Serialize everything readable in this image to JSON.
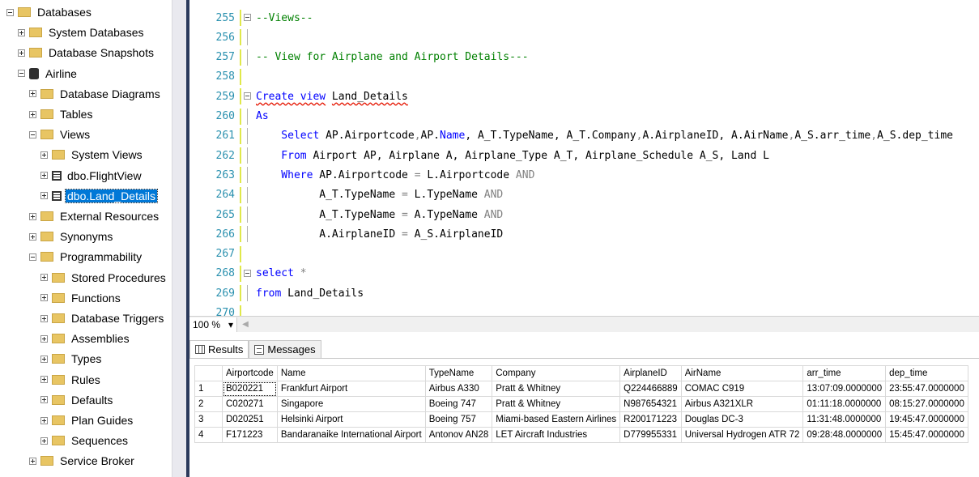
{
  "explorer": {
    "nodes": [
      {
        "label": "Databases",
        "exp": "minus",
        "icon": "folder",
        "indent": 0
      },
      {
        "label": "System Databases",
        "exp": "plus",
        "icon": "folder",
        "indent": 1
      },
      {
        "label": "Database Snapshots",
        "exp": "plus",
        "icon": "folder",
        "indent": 1
      },
      {
        "label": "Airline",
        "exp": "minus",
        "icon": "database",
        "indent": 1
      },
      {
        "label": "Database Diagrams",
        "exp": "plus",
        "icon": "folder",
        "indent": 2
      },
      {
        "label": "Tables",
        "exp": "plus",
        "icon": "folder",
        "indent": 2
      },
      {
        "label": "Views",
        "exp": "minus",
        "icon": "folder",
        "indent": 2
      },
      {
        "label": "System Views",
        "exp": "plus",
        "icon": "folder",
        "indent": 3
      },
      {
        "label": "dbo.FlightView",
        "exp": "plus",
        "icon": "view",
        "indent": 3
      },
      {
        "label": "dbo.Land_Details",
        "exp": "plus",
        "icon": "view",
        "indent": 3,
        "selected": true
      },
      {
        "label": "External Resources",
        "exp": "plus",
        "icon": "folder",
        "indent": 2
      },
      {
        "label": "Synonyms",
        "exp": "plus",
        "icon": "folder",
        "indent": 2
      },
      {
        "label": "Programmability",
        "exp": "minus",
        "icon": "folder",
        "indent": 2
      },
      {
        "label": "Stored Procedures",
        "exp": "plus",
        "icon": "folder",
        "indent": 3
      },
      {
        "label": "Functions",
        "exp": "plus",
        "icon": "folder",
        "indent": 3
      },
      {
        "label": "Database Triggers",
        "exp": "plus",
        "icon": "folder",
        "indent": 3
      },
      {
        "label": "Assemblies",
        "exp": "plus",
        "icon": "folder",
        "indent": 3
      },
      {
        "label": "Types",
        "exp": "plus",
        "icon": "folder",
        "indent": 3
      },
      {
        "label": "Rules",
        "exp": "plus",
        "icon": "folder",
        "indent": 3
      },
      {
        "label": "Defaults",
        "exp": "plus",
        "icon": "folder",
        "indent": 3
      },
      {
        "label": "Plan Guides",
        "exp": "plus",
        "icon": "folder",
        "indent": 3
      },
      {
        "label": "Sequences",
        "exp": "plus",
        "icon": "folder",
        "indent": 3
      },
      {
        "label": "Service Broker",
        "exp": "plus",
        "icon": "folder",
        "indent": 2
      }
    ]
  },
  "editor": {
    "lines": [
      {
        "num": "255",
        "fold": "box",
        "bar": true,
        "tokens": [
          {
            "t": "--Views--",
            "c": "cm"
          }
        ]
      },
      {
        "num": "256",
        "fold": "line",
        "bar": true,
        "tokens": []
      },
      {
        "num": "257",
        "fold": "line",
        "bar": true,
        "tokens": [
          {
            "t": "-- View for Airplane and Airport Details---",
            "c": "cm"
          }
        ]
      },
      {
        "num": "258",
        "fold": "",
        "bar": true,
        "tokens": []
      },
      {
        "num": "259",
        "fold": "box",
        "bar": true,
        "tokens": [
          {
            "t": "Create view",
            "c": "kw sq"
          },
          {
            "t": " ",
            "c": ""
          },
          {
            "t": "Land_Details",
            "c": "sq"
          }
        ]
      },
      {
        "num": "260",
        "fold": "line",
        "bar": true,
        "tokens": [
          {
            "t": "As",
            "c": "kw"
          }
        ]
      },
      {
        "num": "261",
        "fold": "line",
        "bar": true,
        "tokens": [
          {
            "t": "    Select",
            "c": "kw"
          },
          {
            "t": " AP.Airportcode",
            "c": ""
          },
          {
            "t": ",",
            "c": "op"
          },
          {
            "t": "AP.",
            "c": ""
          },
          {
            "t": "Name",
            "c": "kw"
          },
          {
            "t": ", A_T.TypeName, A_T.Company",
            "c": ""
          },
          {
            "t": ",",
            "c": "op"
          },
          {
            "t": "A.AirplaneID, A.AirName",
            "c": ""
          },
          {
            "t": ",",
            "c": "op"
          },
          {
            "t": "A_S.arr_time",
            "c": ""
          },
          {
            "t": ",",
            "c": "op"
          },
          {
            "t": "A_S.dep_time",
            "c": ""
          }
        ]
      },
      {
        "num": "262",
        "fold": "line",
        "bar": true,
        "tokens": [
          {
            "t": "    From",
            "c": "kw"
          },
          {
            "t": " Airport AP, Airplane A, Airplane_Type A_T, Airplane_Schedule A_S, Land L",
            "c": ""
          }
        ]
      },
      {
        "num": "263",
        "fold": "line",
        "bar": true,
        "tokens": [
          {
            "t": "    Where",
            "c": "kw"
          },
          {
            "t": " AP.Airportcode ",
            "c": ""
          },
          {
            "t": "=",
            "c": "op"
          },
          {
            "t": " L.Airportcode ",
            "c": ""
          },
          {
            "t": "AND",
            "c": "op"
          }
        ]
      },
      {
        "num": "264",
        "fold": "line",
        "bar": true,
        "tokens": [
          {
            "t": "          A_T.TypeName ",
            "c": ""
          },
          {
            "t": "=",
            "c": "op"
          },
          {
            "t": " L.TypeName ",
            "c": ""
          },
          {
            "t": "AND",
            "c": "op"
          }
        ]
      },
      {
        "num": "265",
        "fold": "line",
        "bar": true,
        "tokens": [
          {
            "t": "          A_T.TypeName ",
            "c": ""
          },
          {
            "t": "=",
            "c": "op"
          },
          {
            "t": " A.TypeName ",
            "c": ""
          },
          {
            "t": "AND",
            "c": "op"
          }
        ]
      },
      {
        "num": "266",
        "fold": "line",
        "bar": true,
        "tokens": [
          {
            "t": "          A.AirplaneID ",
            "c": ""
          },
          {
            "t": "=",
            "c": "op"
          },
          {
            "t": " A_S.AirplaneID",
            "c": ""
          }
        ]
      },
      {
        "num": "267",
        "fold": "",
        "bar": true,
        "tokens": []
      },
      {
        "num": "268",
        "fold": "box",
        "bar": true,
        "tokens": [
          {
            "t": "select",
            "c": "kw"
          },
          {
            "t": " ",
            "c": ""
          },
          {
            "t": "*",
            "c": "op"
          }
        ]
      },
      {
        "num": "269",
        "fold": "line",
        "bar": true,
        "tokens": [
          {
            "t": "from",
            "c": "kw"
          },
          {
            "t": " Land_Details",
            "c": ""
          }
        ]
      },
      {
        "num": "270",
        "fold": "",
        "bar": true,
        "tokens": []
      }
    ]
  },
  "zoom": {
    "value": "100 %",
    "caret": "▾",
    "scroll_left": "◀"
  },
  "result_tabs": {
    "results": "Results",
    "messages": "Messages"
  },
  "results": {
    "columns": [
      "Airportcode",
      "Name",
      "TypeName",
      "Company",
      "AirplaneID",
      "AirName",
      "arr_time",
      "dep_time"
    ],
    "rows": [
      [
        "1",
        "B020221",
        "Frankfurt Airport",
        "Airbus A330",
        "Pratt & Whitney",
        "Q224466889",
        "COMAC C919",
        "13:07:09.0000000",
        "23:55:47.0000000"
      ],
      [
        "2",
        "C020271",
        "Singapore",
        "Boeing 747",
        "Pratt & Whitney",
        "N987654321",
        "Airbus A321XLR",
        "01:11:18.0000000",
        "08:15:27.0000000"
      ],
      [
        "3",
        "D020251",
        "Helsinki Airport",
        "Boeing 757",
        "Miami-based Eastern Airlines",
        "R200171223",
        "Douglas DC-3",
        "11:31:48.0000000",
        "19:45:47.0000000"
      ],
      [
        "4",
        "F171223",
        "Bandaranaike International Airport",
        "Antonov AN28",
        "LET Aircraft Industries",
        "D779955331",
        "Universal Hydrogen ATR 72",
        "09:28:48.0000000",
        "15:45:47.0000000"
      ]
    ]
  },
  "colors": {
    "keyword": "#0000ff",
    "comment": "#008000",
    "line_number": "#2b91af",
    "selection": "#0078d7",
    "folder": "#e8c563"
  }
}
